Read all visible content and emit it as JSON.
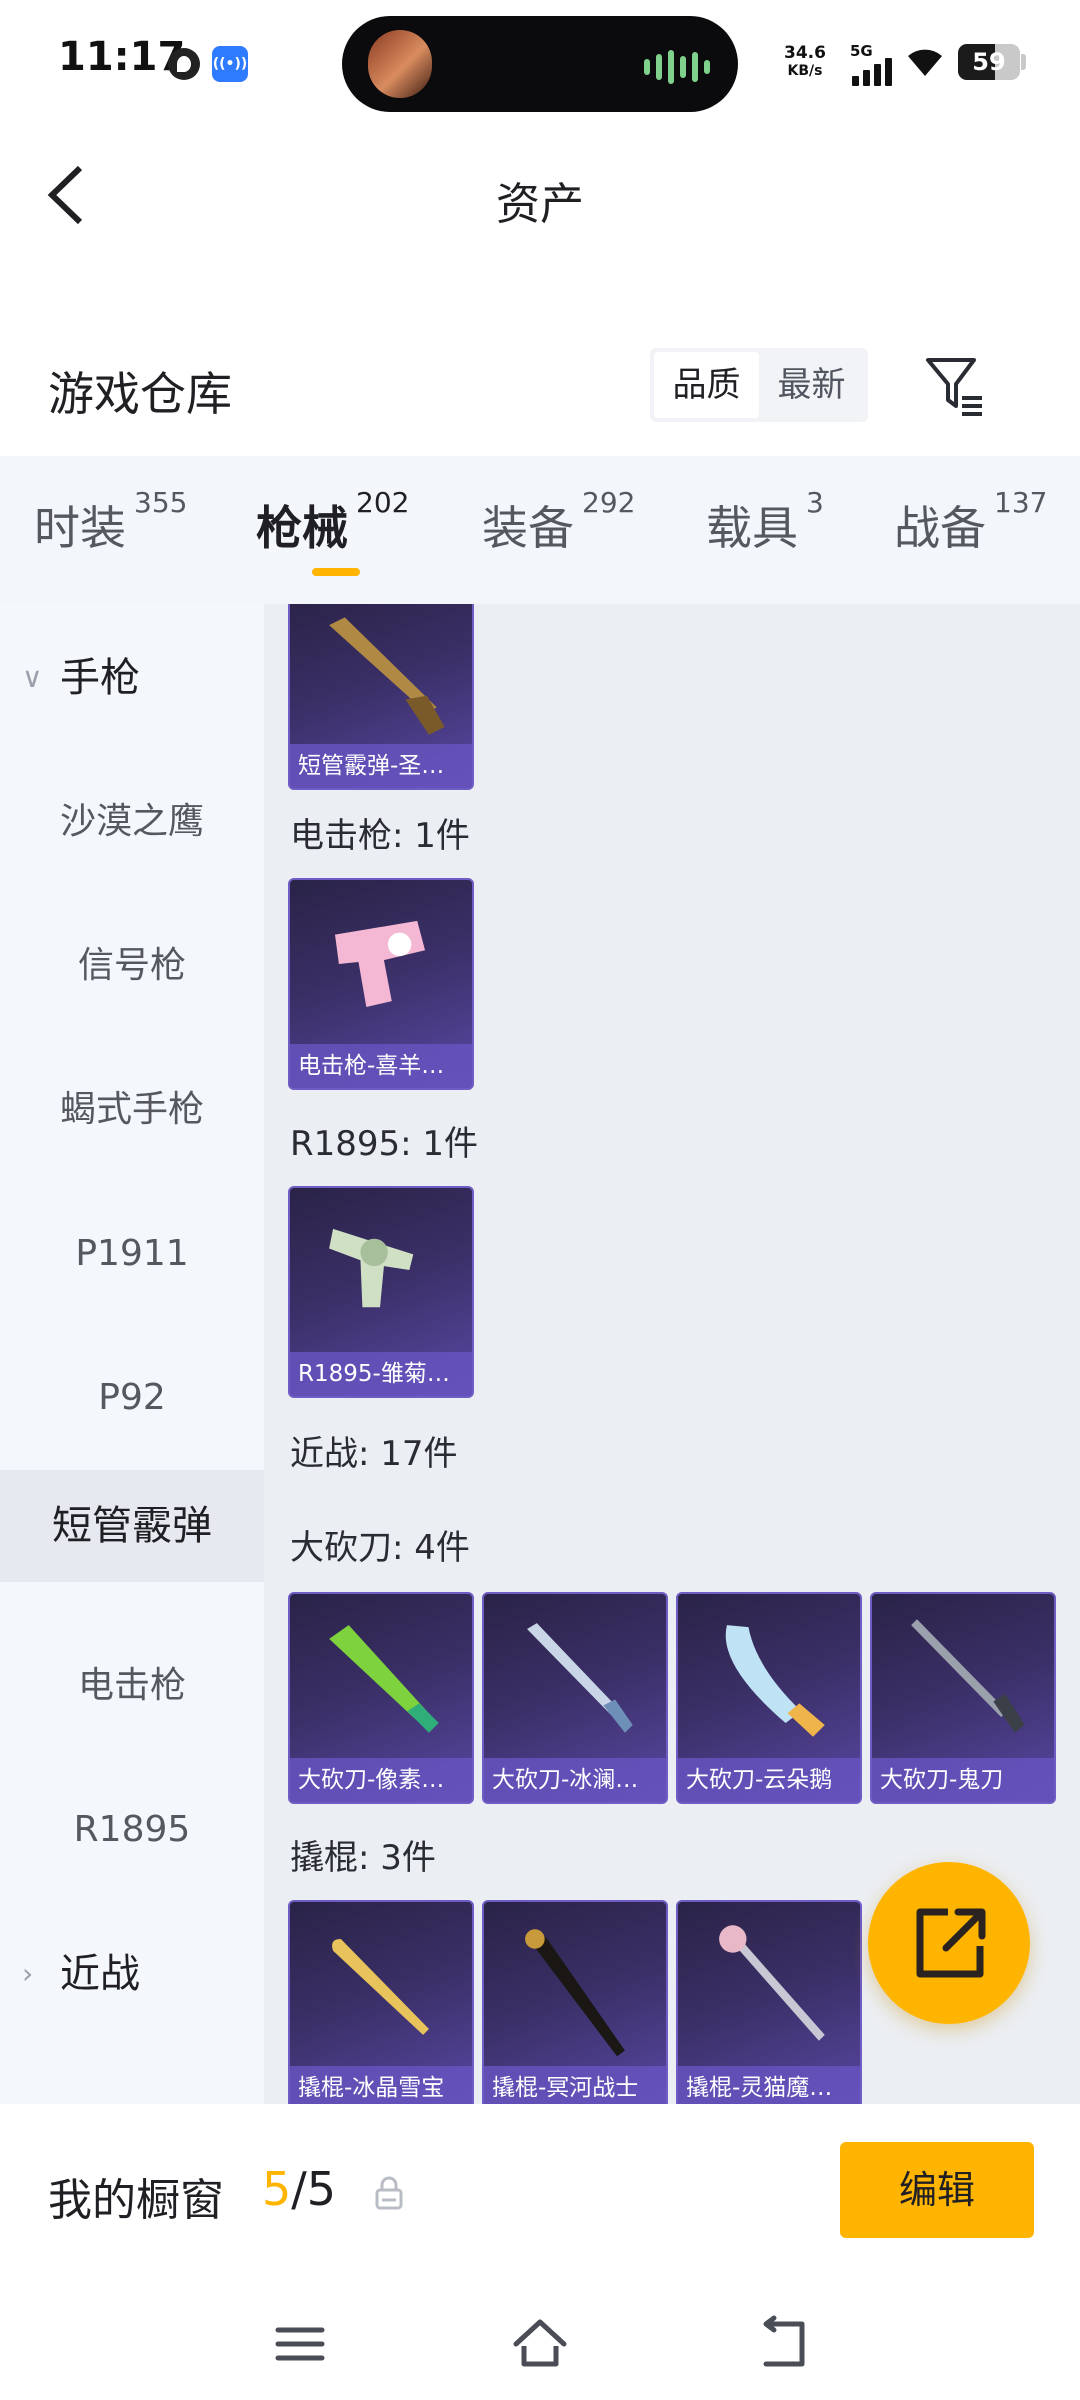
{
  "status_bar": {
    "time": "11:17",
    "net_speed_value": "34.6",
    "net_speed_unit": "KB/s",
    "network": "5G",
    "battery": "59",
    "battery_level": 0.59
  },
  "header": {
    "title": "资产",
    "back_icon": "chevron-left-icon"
  },
  "warehouse": {
    "title": "游戏仓库",
    "sort_options": [
      "品质",
      "最新"
    ],
    "sort_selected": "品质",
    "filter_icon": "filter-icon"
  },
  "tabs": [
    {
      "label": "时装",
      "count": "355"
    },
    {
      "label": "枪械",
      "count": "202"
    },
    {
      "label": "装备",
      "count": "292"
    },
    {
      "label": "载具",
      "count": "3"
    },
    {
      "label": "战备",
      "count": "137"
    }
  ],
  "active_tab": "枪械",
  "sidebar": {
    "groups": [
      {
        "label": "手枪",
        "expanded": true,
        "items": [
          "沙漠之鹰",
          "信号枪",
          "蝎式手枪",
          "P1911",
          "P92",
          "短管霰弹",
          "电击枪",
          "R1895"
        ]
      },
      {
        "label": "近战",
        "expanded": false
      }
    ],
    "selected": "短管霰弹"
  },
  "content": {
    "partial_card": {
      "caption": "短管霰弹-圣…"
    },
    "sections": [
      {
        "label": "电击枪: 1件",
        "items": [
          "电击枪-喜羊…"
        ]
      },
      {
        "label": "R1895: 1件",
        "items": [
          "R1895-雏菊…"
        ]
      },
      {
        "label": "近战: 17件",
        "items": []
      },
      {
        "label": "大砍刀: 4件",
        "items": [
          "大砍刀-像素…",
          "大砍刀-冰澜…",
          "大砍刀-云朵鹅",
          "大砍刀-鬼刀"
        ]
      },
      {
        "label": "撬棍: 3件",
        "items": [
          "撬棍-冰晶雪宝",
          "撬棍-冥河战士",
          "撬棍-灵猫魔…"
        ]
      }
    ]
  },
  "fab": {
    "icon": "share-external-icon"
  },
  "showcase": {
    "label": "我的橱窗",
    "current": "5",
    "separator": "/",
    "total": "5",
    "edit_label": "编辑",
    "lock_icon": "lock-icon"
  },
  "nav": {
    "icons": [
      "menu-icon",
      "home-icon",
      "back-icon"
    ]
  },
  "colors": {
    "accent": "#ffb400",
    "card_bg": "#3a2f66",
    "card_caption": "#6654be",
    "sidebar_bg": "#f4f7fc",
    "content_bg": "#ebeef2"
  }
}
